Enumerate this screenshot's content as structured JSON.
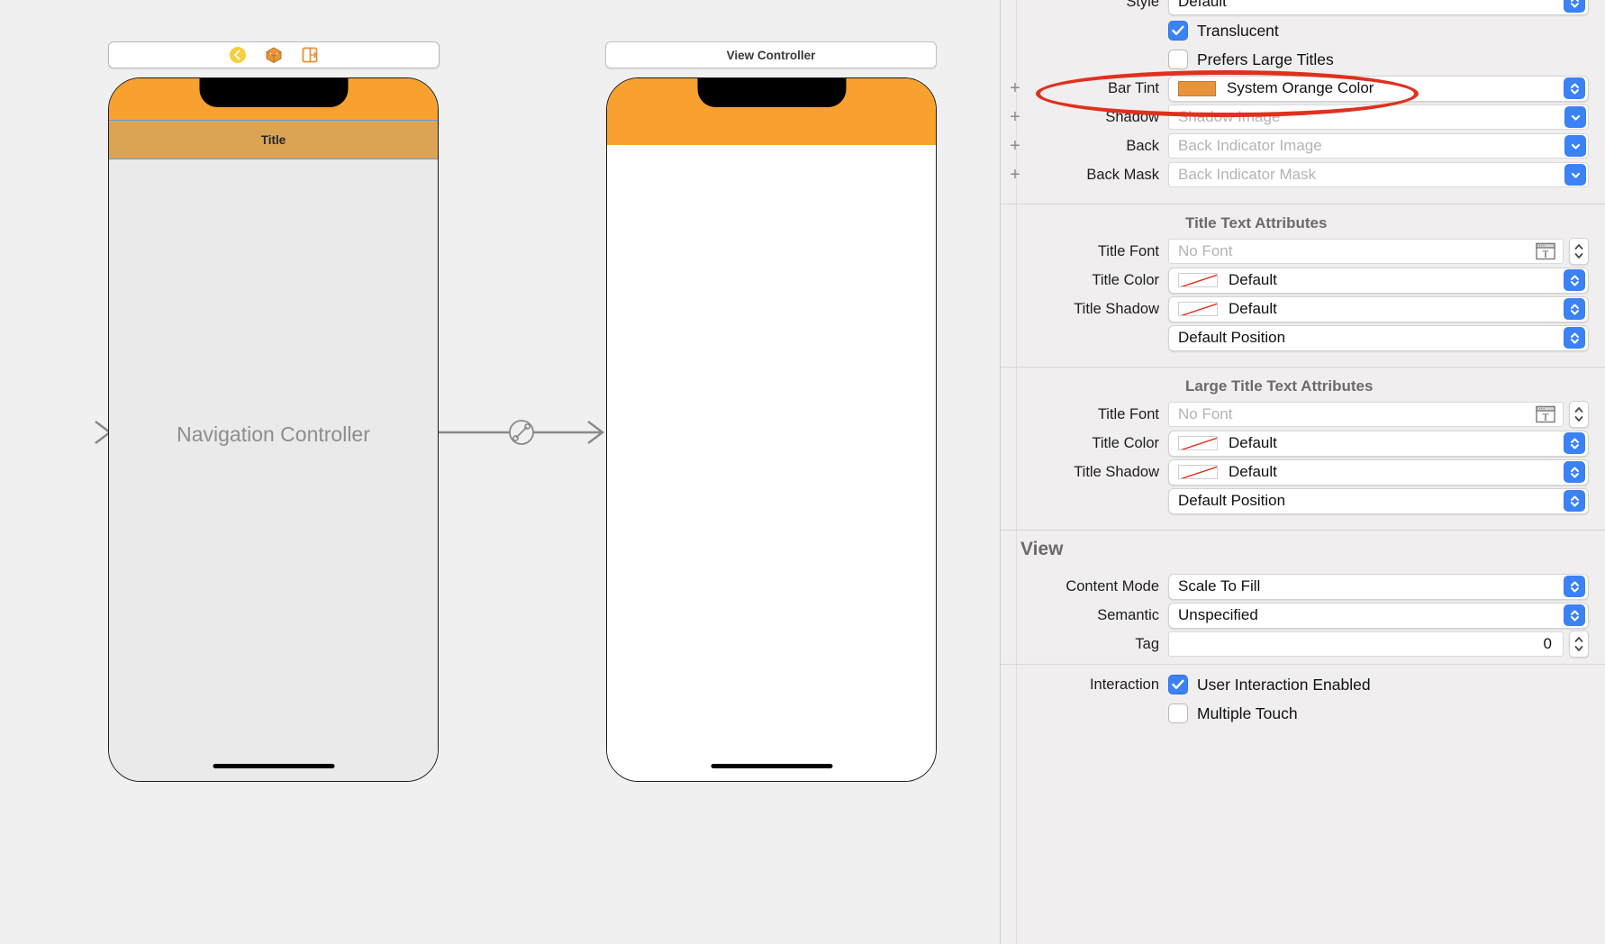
{
  "canvas": {
    "scene1": {
      "dock_icons": [
        "view-controller-icon",
        "first-responder-icon",
        "exit-icon"
      ],
      "label": "Navigation Controller",
      "navbar_title": "Title"
    },
    "scene2": {
      "title": "View Controller"
    },
    "segue_icon": "relationship-segue-icon",
    "entry_arrow": "storyboard-entry-point-arrow"
  },
  "inspector": {
    "navigation_bar": {
      "style": {
        "label": "Style",
        "value": "Default"
      },
      "translucent": {
        "label": "Translucent",
        "checked": true
      },
      "prefers_large_titles": {
        "label": "Prefers Large Titles",
        "checked": false
      },
      "bar_tint": {
        "label": "Bar Tint",
        "value": "System Orange Color",
        "swatch": "#e8943a"
      },
      "shadow": {
        "label": "Shadow",
        "placeholder": "Shadow Image"
      },
      "back": {
        "label": "Back",
        "placeholder": "Back Indicator Image"
      },
      "back_mask": {
        "label": "Back Mask",
        "placeholder": "Back Indicator Mask"
      }
    },
    "title_text_attributes": {
      "heading": "Title Text Attributes",
      "title_font": {
        "label": "Title Font",
        "placeholder": "No Font"
      },
      "title_color": {
        "label": "Title Color",
        "value": "Default"
      },
      "title_shadow": {
        "label": "Title Shadow",
        "value": "Default"
      },
      "position": {
        "value": "Default Position"
      }
    },
    "large_title_text_attributes": {
      "heading": "Large Title Text Attributes",
      "title_font": {
        "label": "Title Font",
        "placeholder": "No Font"
      },
      "title_color": {
        "label": "Title Color",
        "value": "Default"
      },
      "title_shadow": {
        "label": "Title Shadow",
        "value": "Default"
      },
      "position": {
        "value": "Default Position"
      }
    },
    "view": {
      "heading": "View",
      "content_mode": {
        "label": "Content Mode",
        "value": "Scale To Fill"
      },
      "semantic": {
        "label": "Semantic",
        "value": "Unspecified"
      },
      "tag": {
        "label": "Tag",
        "value": "0"
      },
      "interaction": {
        "label": "Interaction"
      },
      "user_interaction_enabled": {
        "label": "User Interaction Enabled",
        "checked": true
      },
      "multiple_touch": {
        "label": "Multiple Touch",
        "checked": false
      }
    },
    "plus_glyph": "+",
    "accent_color": "#3b82f6",
    "annotation_color": "#e0301e"
  }
}
